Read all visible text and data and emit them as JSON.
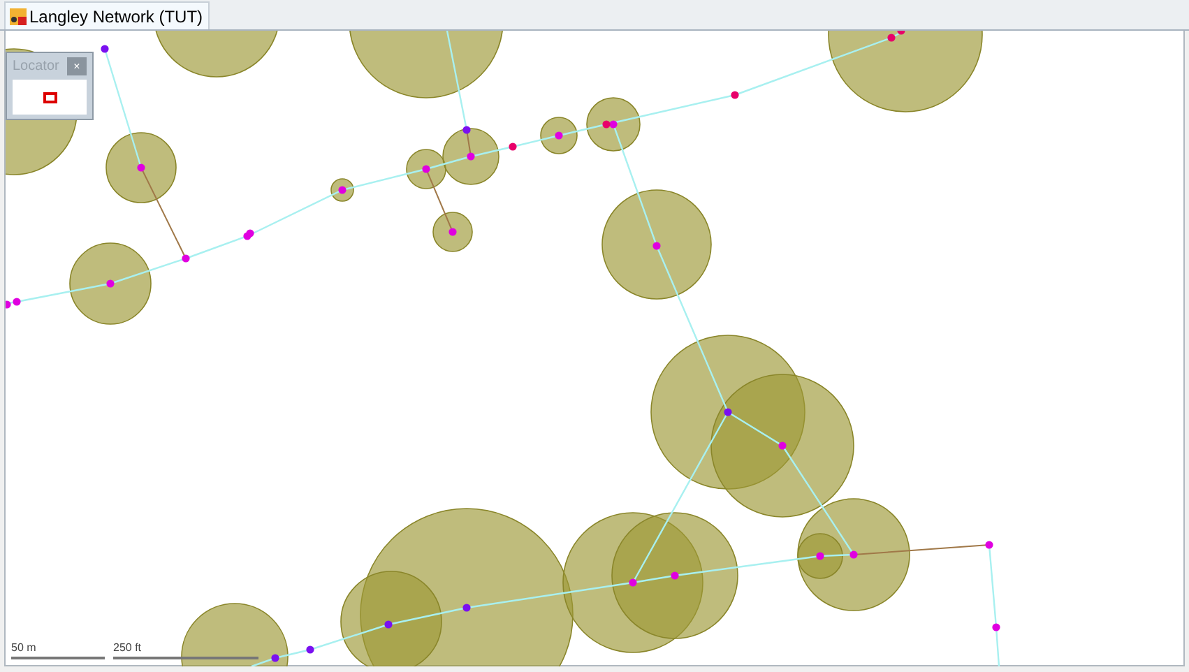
{
  "tabs": [
    {
      "label": "Langley Network (TUT)",
      "selected": true
    }
  ],
  "locator": {
    "title": "Locator",
    "close": "×"
  },
  "scale_bar": [
    {
      "label": "50 m"
    },
    {
      "label": "250 ft"
    }
  ]
}
